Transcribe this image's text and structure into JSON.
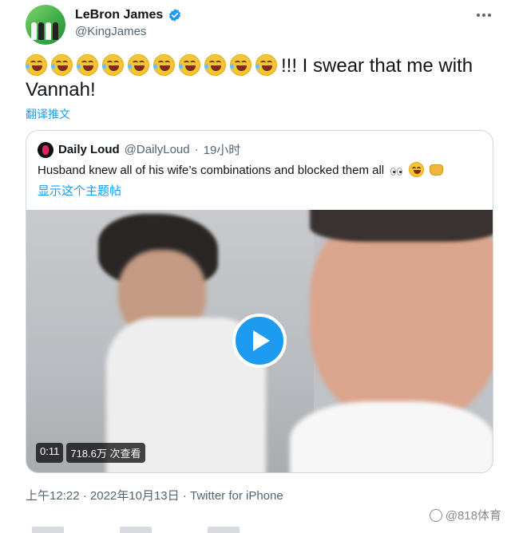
{
  "author": {
    "name": "LeBron James",
    "handle": "@KingJames",
    "verified_icon": "verified-badge-icon",
    "verified_color": "#1d9bf0"
  },
  "tweet": {
    "emoji_count": 10,
    "text_line1": "!!! I swear that me with",
    "text_line2": "Vannah!",
    "translate_label": "翻译推文"
  },
  "quote": {
    "name": "Daily Loud",
    "handle": "@DailyLoud",
    "separator": "·",
    "time": "19小时",
    "text": "Husband knew all of his wife’s combinations and blocked them all",
    "show_thread": "显示这个主题帖",
    "video": {
      "duration": "0:11",
      "views": "718.6万 次查看",
      "play_icon": "play-icon"
    }
  },
  "meta": {
    "time": "上午12:22",
    "separator": " · ",
    "date": "2022年10月13日",
    "source": "Twitter for iPhone"
  },
  "watermark": {
    "text": "@818体育"
  },
  "colors": {
    "link": "#1d9bf0",
    "secondary": "#536471",
    "border": "#cfd9de"
  }
}
